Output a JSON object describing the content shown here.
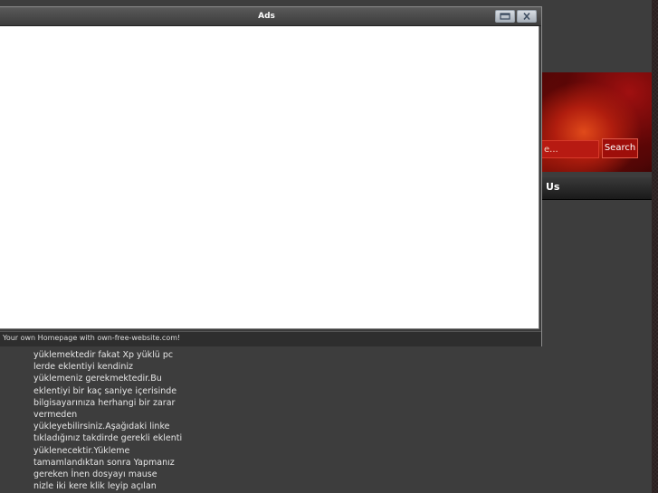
{
  "popup": {
    "title": "Ads",
    "footer_text": "Your own Homepage with own-free-website.com!"
  },
  "site": {
    "search_placeholder": "e...",
    "search_button": "Search",
    "nav_item": "Us",
    "body_lines": [
      "yüklemektedir fakat Xp yüklü pc",
      "lerde eklentiyi kendiniz",
      "yüklemeniz gerekmektedir.Bu",
      "eklentiyi bir kaç saniye içerisinde",
      "bilgisayarınıza herhangi bir zarar",
      "vermeden",
      "yükleyebilirsiniz.Aşağıdaki linke",
      "tıkladığınız takdirde gerekli eklenti",
      "yüklenecektir.Yükleme",
      "tamamlandıktan sonra Yapmanız",
      "gereken İnen dosyayı mause",
      "nizle iki kere klik leyip açılan"
    ]
  },
  "colors": {
    "search_bg": "#b71a12",
    "popup_content_bg": "#ffffff",
    "site_bg": "#3d3d3d"
  }
}
